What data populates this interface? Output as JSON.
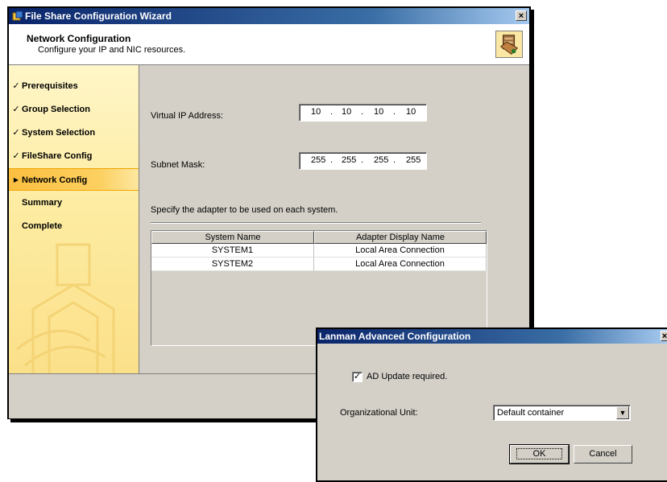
{
  "wizard": {
    "title": "File Share Configuration Wizard",
    "close_glyph": "×",
    "header_title": "Network Configuration",
    "header_subtitle": "Configure your IP and NIC resources.",
    "steps": [
      {
        "label": "Prerequisites",
        "state": "done",
        "mark": "✓"
      },
      {
        "label": "Group Selection",
        "state": "done",
        "mark": "✓"
      },
      {
        "label": "System Selection",
        "state": "done",
        "mark": "✓"
      },
      {
        "label": "FileShare Config",
        "state": "done",
        "mark": "✓"
      },
      {
        "label": "Network Config",
        "state": "active",
        "mark": "▶"
      },
      {
        "label": "Summary",
        "state": "pending",
        "mark": ""
      },
      {
        "label": "Complete",
        "state": "pending",
        "mark": ""
      }
    ],
    "virtual_ip_label": "Virtual IP Address:",
    "virtual_ip": [
      "10",
      "10",
      "10",
      "10"
    ],
    "subnet_label": "Subnet Mask:",
    "subnet": [
      "255",
      "255",
      "255",
      "255"
    ],
    "adapter_instruction": "Specify the adapter to be used on each system.",
    "table": {
      "columns": [
        "System Name",
        "Adapter Display Name"
      ],
      "rows": [
        [
          "SYSTEM1",
          "Local Area Connection"
        ],
        [
          "SYSTEM2",
          "Local Area Connection"
        ]
      ]
    }
  },
  "lanman": {
    "title": "Lanman Advanced Configuration",
    "close_glyph": "×",
    "ad_update_label": "AD Update required.",
    "ad_update_checked": true,
    "check_glyph": "✓",
    "ou_label": "Organizational Unit:",
    "ou_value": "Default container",
    "arrow_glyph": "▼",
    "ok_label": "OK",
    "cancel_label": "Cancel"
  }
}
